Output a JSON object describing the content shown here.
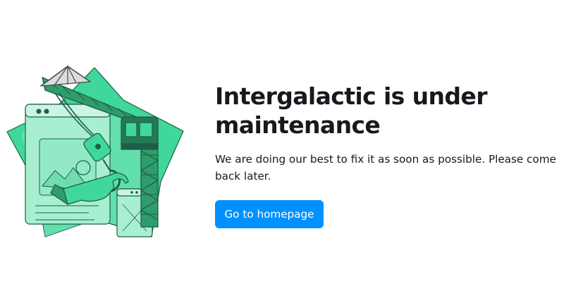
{
  "illustration": {
    "icon": "maintenance-crane-star-icon",
    "colors": {
      "mint": "#3fd89a",
      "mint_light": "#a8efd1",
      "dark_green": "#237a55",
      "stroke": "#1f5e46"
    }
  },
  "main": {
    "title": "Intergalactic is under maintenance",
    "subtitle": "We are doing our best to fix it as soon as possible. Please come back later.",
    "button_label": "Go to homepage"
  },
  "colors": {
    "text": "#18191f",
    "button_bg": "#0091ff",
    "button_text": "#ffffff"
  }
}
